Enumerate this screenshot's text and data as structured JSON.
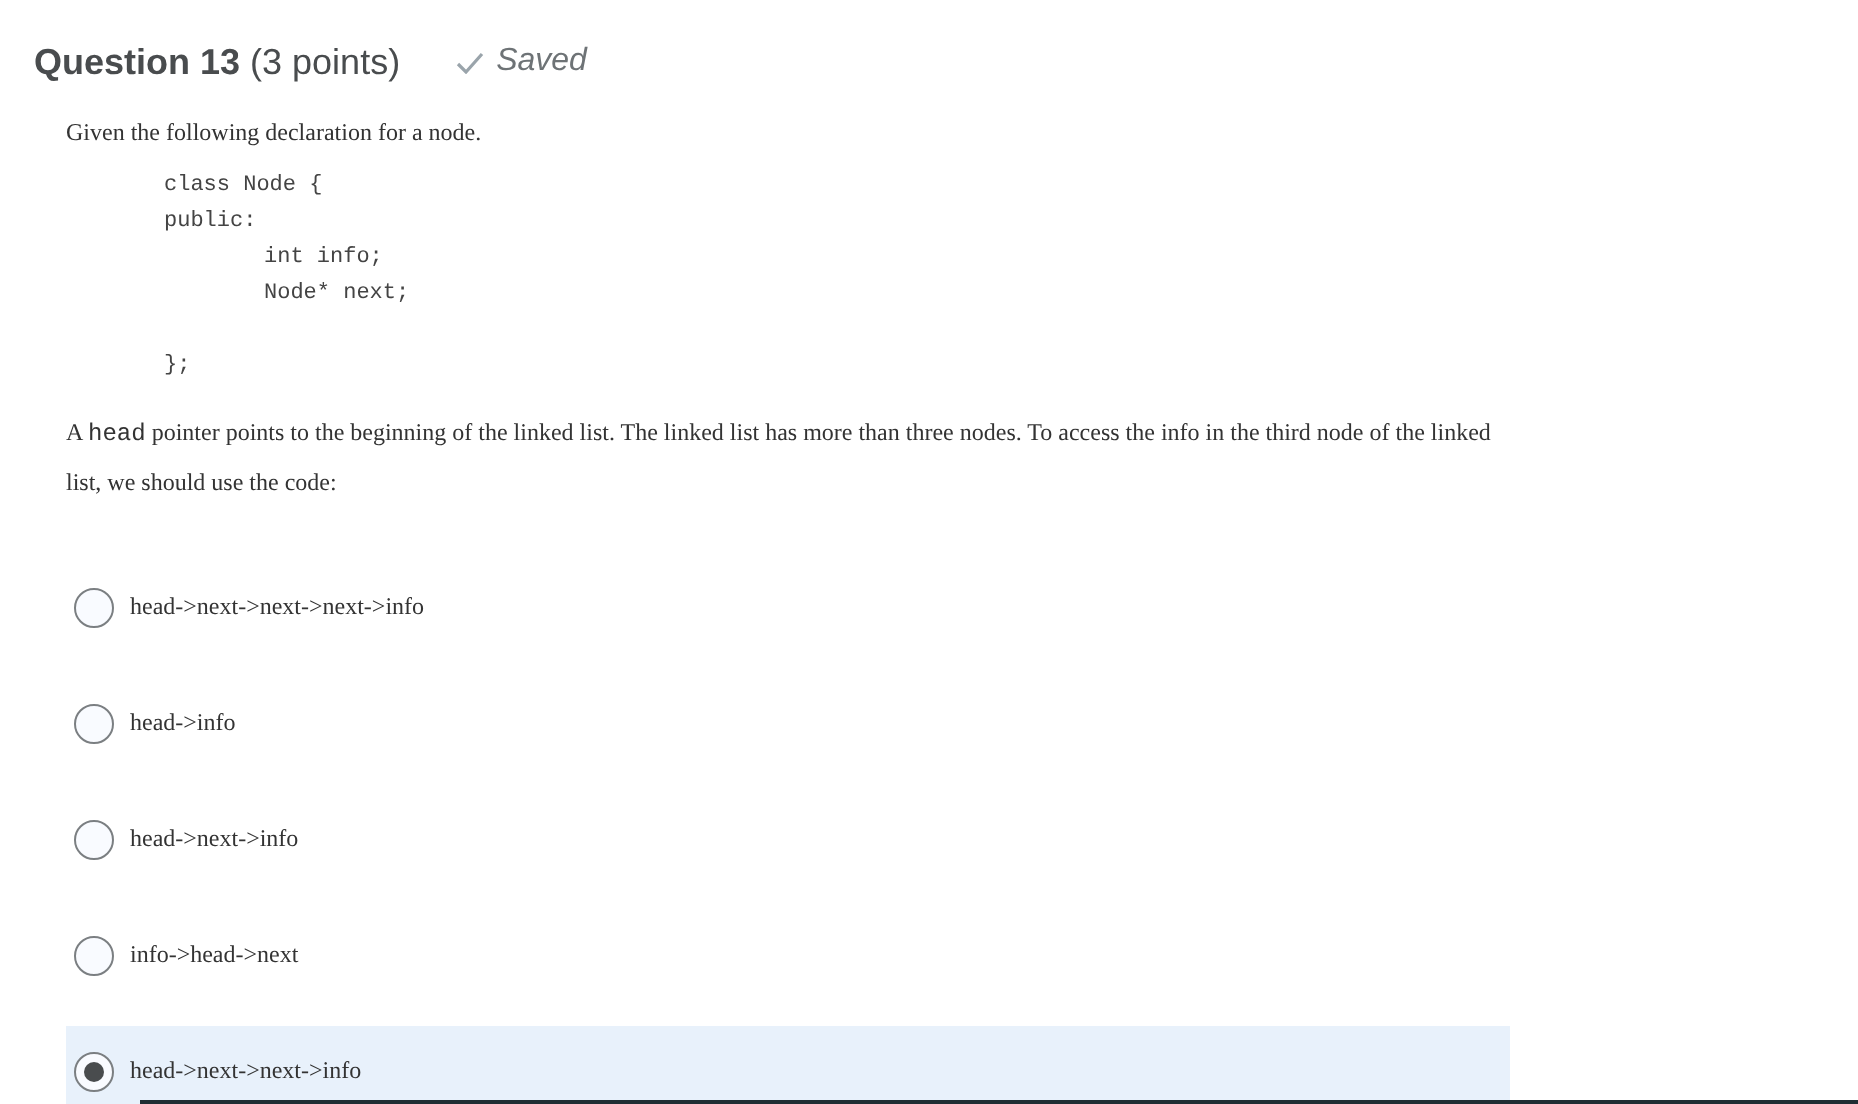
{
  "question": {
    "title": "Question 13",
    "points": "(3 points)",
    "status": "Saved"
  },
  "intro": "Given the following declaration for a node.",
  "code_lines": [
    {
      "kind": "line",
      "text": "class Node {",
      "indented": false
    },
    {
      "kind": "line",
      "text": "public:",
      "indented": false
    },
    {
      "kind": "line",
      "text": "int info;",
      "indented": true
    },
    {
      "kind": "line",
      "text": "Node* next;",
      "indented": true
    },
    {
      "kind": "blank"
    },
    {
      "kind": "line",
      "text": "};",
      "indented": false
    }
  ],
  "prompt": [
    {
      "kind": "text",
      "text": "A "
    },
    {
      "kind": "code",
      "text": "head"
    },
    {
      "kind": "text",
      "text": " pointer points to the beginning of the linked list. The linked list has more than three nodes. To access the info in the third node of the linked list, we should use the code:"
    }
  ],
  "options": [
    {
      "label": "head->next->next->next->info",
      "selected": false
    },
    {
      "label": "head->info",
      "selected": false
    },
    {
      "label": "head->next->info",
      "selected": false
    },
    {
      "label": "info->head->next",
      "selected": false
    },
    {
      "label": "head->next->next->info",
      "selected": true
    }
  ]
}
